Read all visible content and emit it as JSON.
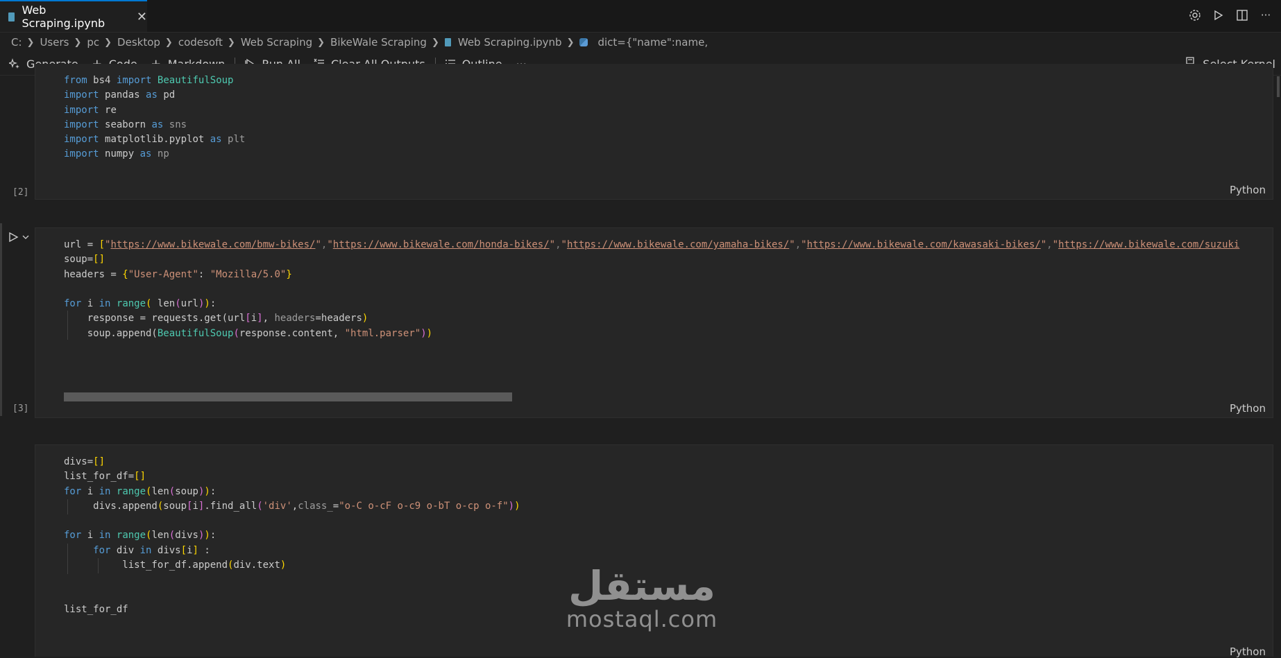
{
  "tab": {
    "title": "Web Scraping.ipynb",
    "close": "✕"
  },
  "top_actions": [
    "settings-icon",
    "run-icon",
    "split-icon",
    "more-icon"
  ],
  "breadcrumb": [
    "C:",
    "Users",
    "pc",
    "Desktop",
    "codesoft",
    "Web Scraping",
    "BikeWale Scraping",
    "Web Scraping.ipynb",
    "dict={\"name\":name,"
  ],
  "toolbar": {
    "generate": "Generate",
    "code": "Code",
    "markdown": "Markdown",
    "run_all": "Run All",
    "clear_outputs": "Clear All Outputs",
    "outline": "Outline",
    "more": "···",
    "select_kernel": "Select Kernel"
  },
  "cells": [
    {
      "count": "[2]",
      "lang": "Python"
    },
    {
      "count": "[3]",
      "lang": "Python"
    },
    {
      "count": "",
      "lang": "Python"
    }
  ],
  "code": {
    "c1": [
      "from",
      "bs4",
      "import",
      "BeautifulSoup",
      "pandas",
      "as",
      "pd",
      "re",
      "seaborn",
      "sns",
      "matplotlib.pyplot",
      "plt",
      "numpy",
      "np"
    ],
    "c2": {
      "urls": [
        "https://www.bikewale.com/bmw-bikes/",
        "https://www.bikewale.com/honda-bikes/",
        "https://www.bikewale.com/yamaha-bikes/",
        "https://www.bikewale.com/kawasaki-bikes/",
        "https://www.bikewale.com/suzuki"
      ],
      "url_var": "url = ",
      "soup_line": "soup=",
      "headers_var": "headers = ",
      "ua_key": "\"User-Agent\"",
      "ua_val": "\"Mozilla/5.0\"",
      "response_line": "response = requests.get(url",
      "soup_append": "soup.append(",
      "parser": "\"html.parser\""
    },
    "c3": {
      "divs": "divs=",
      "lfd": "list_for_df=",
      "div_class": "\"o-C o-cF o-c9 o-bT o-cp o-f\"",
      "div_tag": "'div'",
      "last": "list_for_df"
    }
  },
  "watermark": {
    "arabic": "مستقل",
    "latin": "mostaql.com"
  }
}
